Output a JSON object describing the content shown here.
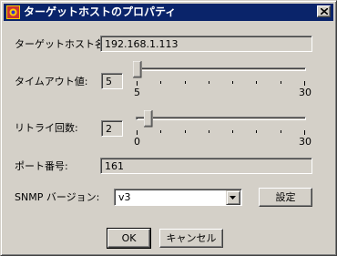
{
  "window": {
    "title": "ターゲットホストのプロパティ",
    "colors": {
      "titlebar": "#0a246a",
      "face": "#d4d0c8"
    }
  },
  "form": {
    "target_host": {
      "label": "ターゲットホスト名:",
      "value": "192.168.1.113"
    },
    "timeout": {
      "label": "タイムアウト値:",
      "value": "5",
      "min_label": "5",
      "max_label": "30",
      "min": 5,
      "max": 30,
      "current": 5
    },
    "retry": {
      "label": "リトライ回数:",
      "value": "2",
      "min_label": "0",
      "max_label": "30",
      "min": 0,
      "max": 30,
      "current": 2
    },
    "port": {
      "label": "ポート番号:",
      "value": "161"
    },
    "snmp": {
      "label": "SNMP バージョン:",
      "selected": "v3",
      "settings_button": "設定"
    }
  },
  "buttons": {
    "ok": "OK",
    "cancel": "キャンセル"
  },
  "icons": {
    "title": "app-icon",
    "close": "close-icon",
    "dropdown": "chevron-down-icon"
  }
}
